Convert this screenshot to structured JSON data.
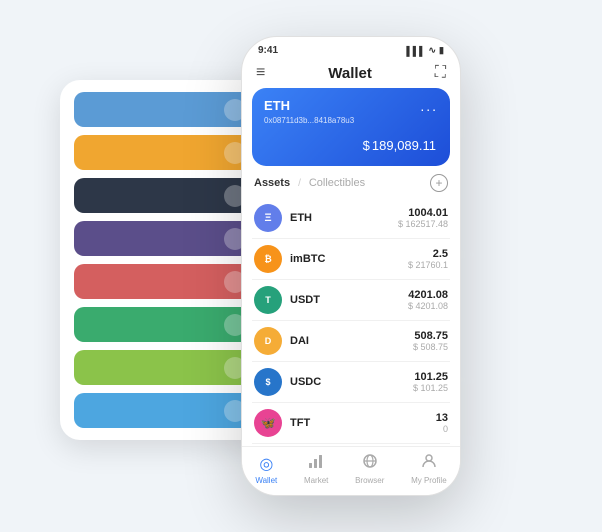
{
  "status_bar": {
    "time": "9:41",
    "signal": "▌▌▌",
    "wifi": "WiFi",
    "battery": "🔋"
  },
  "nav": {
    "title": "Wallet",
    "menu_icon": "≡",
    "expand_icon": "⛶"
  },
  "blue_card": {
    "ticker": "ETH",
    "address": "0x08711d3b...8418a78u3",
    "copy_icon": "⊞",
    "menu_icon": "...",
    "balance_symbol": "$",
    "balance": "189,089.11"
  },
  "assets_section": {
    "tab_active": "Assets",
    "divider": "/",
    "tab_inactive": "Collectibles",
    "add_icon": "+"
  },
  "assets": [
    {
      "name": "ETH",
      "icon": "Ξ",
      "icon_type": "eth",
      "amount": "1004.01",
      "usd": "$ 162517.48"
    },
    {
      "name": "imBTC",
      "icon": "₿",
      "icon_type": "imbtc",
      "amount": "2.5",
      "usd": "$ 21760.1"
    },
    {
      "name": "USDT",
      "icon": "T",
      "icon_type": "usdt",
      "amount": "4201.08",
      "usd": "$ 4201.08"
    },
    {
      "name": "DAI",
      "icon": "D",
      "icon_type": "dai",
      "amount": "508.75",
      "usd": "$ 508.75"
    },
    {
      "name": "USDC",
      "icon": "U",
      "icon_type": "usdc",
      "amount": "101.25",
      "usd": "$ 101.25"
    },
    {
      "name": "TFT",
      "icon": "🦋",
      "icon_type": "tft",
      "amount": "13",
      "usd": "0"
    }
  ],
  "bottom_nav": [
    {
      "label": "Wallet",
      "icon": "◎",
      "active": true
    },
    {
      "label": "Market",
      "icon": "📊",
      "active": false
    },
    {
      "label": "Browser",
      "icon": "👤",
      "active": false
    },
    {
      "label": "My Profile",
      "icon": "👤",
      "active": false
    }
  ],
  "bg_strips": [
    {
      "color": "#5b9bd5",
      "dot": true
    },
    {
      "color": "#f0a630",
      "dot": true
    },
    {
      "color": "#2d3748",
      "dot": true
    },
    {
      "color": "#5b4e8a",
      "dot": true
    },
    {
      "color": "#d45f5f",
      "dot": true
    },
    {
      "color": "#3aab6e",
      "dot": true
    },
    {
      "color": "#8bc34a",
      "dot": true
    },
    {
      "color": "#4da6e0",
      "dot": true
    }
  ]
}
